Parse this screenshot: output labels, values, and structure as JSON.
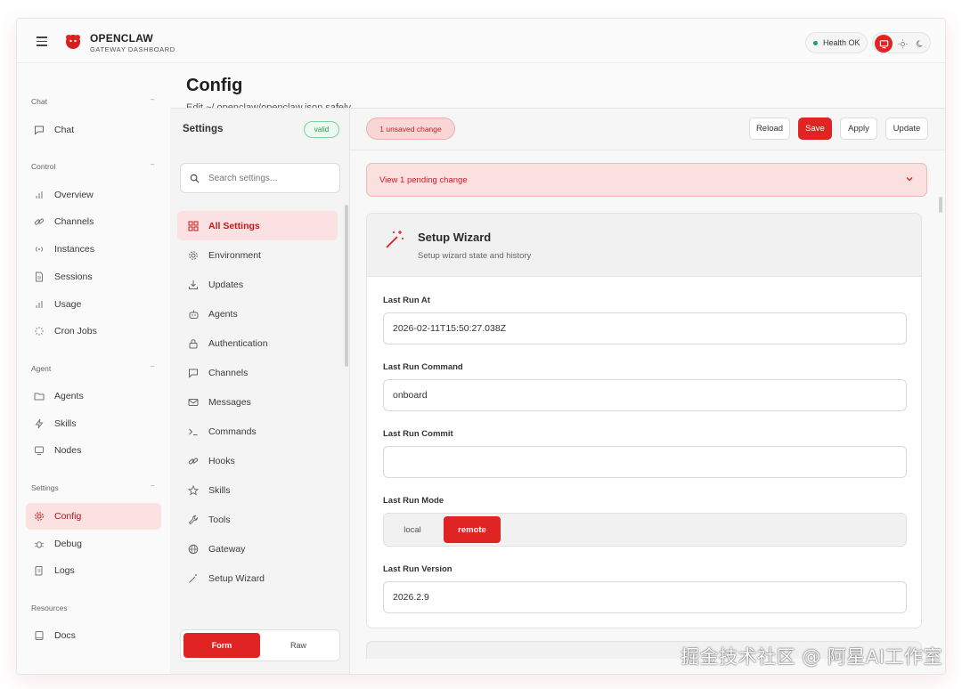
{
  "app": {
    "name": "OPENCLAW",
    "subtitle": "GATEWAY DASHBOARD",
    "health_label": "Health",
    "health_status": "OK",
    "accent_color": "#e02424"
  },
  "sidebar": {
    "groups": [
      {
        "label": "Chat",
        "items": [
          {
            "label": "Chat",
            "icon": "chat-bubble-icon"
          }
        ]
      },
      {
        "label": "Control",
        "items": [
          {
            "label": "Overview",
            "icon": "bar-chart-icon"
          },
          {
            "label": "Channels",
            "icon": "link-icon"
          },
          {
            "label": "Instances",
            "icon": "broadcast-icon"
          },
          {
            "label": "Sessions",
            "icon": "document-icon"
          },
          {
            "label": "Usage",
            "icon": "bar-chart-icon"
          },
          {
            "label": "Cron Jobs",
            "icon": "loader-icon"
          }
        ]
      },
      {
        "label": "Agent",
        "items": [
          {
            "label": "Agents",
            "icon": "folder-icon"
          },
          {
            "label": "Skills",
            "icon": "lightning-icon"
          },
          {
            "label": "Nodes",
            "icon": "monitor-icon"
          }
        ]
      },
      {
        "label": "Settings",
        "items": [
          {
            "label": "Config",
            "icon": "gear-icon",
            "active": true
          },
          {
            "label": "Debug",
            "icon": "bug-icon"
          },
          {
            "label": "Logs",
            "icon": "scroll-icon"
          }
        ]
      },
      {
        "label": "Resources",
        "items": [
          {
            "label": "Docs",
            "icon": "book-icon"
          }
        ]
      }
    ]
  },
  "page": {
    "title": "Config",
    "subtitle": "Edit ~/.openclaw/openclaw.json safely."
  },
  "settings": {
    "heading": "Settings",
    "status_badge": "valid",
    "search_placeholder": "Search settings...",
    "items": [
      {
        "label": "All Settings",
        "icon": "grid-icon",
        "active": true
      },
      {
        "label": "Environment",
        "icon": "gear-icon"
      },
      {
        "label": "Updates",
        "icon": "download-icon"
      },
      {
        "label": "Agents",
        "icon": "robot-icon"
      },
      {
        "label": "Authentication",
        "icon": "lock-icon"
      },
      {
        "label": "Channels",
        "icon": "chat-bubble-icon"
      },
      {
        "label": "Messages",
        "icon": "mail-icon"
      },
      {
        "label": "Commands",
        "icon": "terminal-icon"
      },
      {
        "label": "Hooks",
        "icon": "link-icon"
      },
      {
        "label": "Skills",
        "icon": "star-icon"
      },
      {
        "label": "Tools",
        "icon": "wrench-icon"
      },
      {
        "label": "Gateway",
        "icon": "globe-icon"
      },
      {
        "label": "Setup Wizard",
        "icon": "wand-icon"
      }
    ],
    "mode_form": "Form",
    "mode_raw": "Raw"
  },
  "toolbar": {
    "unsaved": "1 unsaved change",
    "reload": "Reload",
    "save": "Save",
    "apply": "Apply",
    "update": "Update"
  },
  "pending": {
    "label": "View 1 pending change"
  },
  "section": {
    "title": "Setup Wizard",
    "subtitle": "Setup wizard state and history",
    "fields": {
      "last_run_at": {
        "label": "Last Run At",
        "value": "2026-02-11T15:50:27.038Z"
      },
      "last_run_command": {
        "label": "Last Run Command",
        "value": "onboard"
      },
      "last_run_commit": {
        "label": "Last Run Commit",
        "value": ""
      },
      "last_run_mode": {
        "label": "Last Run Mode",
        "options": [
          "local",
          "remote"
        ],
        "selected": "remote"
      },
      "last_run_version": {
        "label": "Last Run Version",
        "value": "2026.2.9"
      }
    }
  },
  "watermark": "掘金技术社区 @ 阿星AI工作室"
}
